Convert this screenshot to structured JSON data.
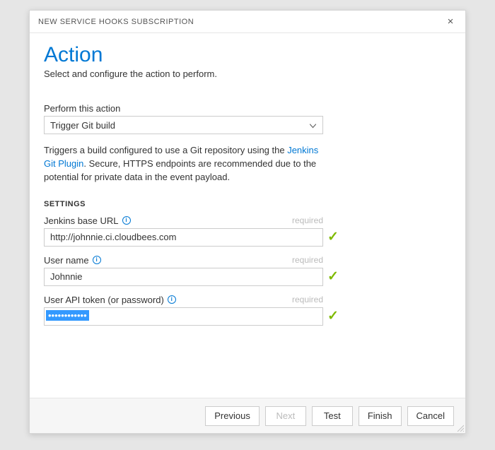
{
  "dialog": {
    "title": "NEW SERVICE HOOKS SUBSCRIPTION"
  },
  "page": {
    "heading": "Action",
    "subtitle": "Select and configure the action to perform."
  },
  "action": {
    "label": "Perform this action",
    "selected": "Trigger Git build",
    "help_prefix": "Triggers a build configured to use a Git repository using the ",
    "help_link": "Jenkins Git Plugin",
    "help_suffix": ". Secure, HTTPS endpoints are recommended due to the potential for private data in the event payload."
  },
  "settings": {
    "header": "SETTINGS",
    "required_text": "required",
    "jenkins_url": {
      "label": "Jenkins base URL",
      "value": "http://johnnie.ci.cloudbees.com"
    },
    "username": {
      "label": "User name",
      "value": "Johnnie"
    },
    "api_token": {
      "label": "User API token (or password)",
      "value": "••••••••••••"
    }
  },
  "buttons": {
    "previous": "Previous",
    "next": "Next",
    "test": "Test",
    "finish": "Finish",
    "cancel": "Cancel"
  }
}
